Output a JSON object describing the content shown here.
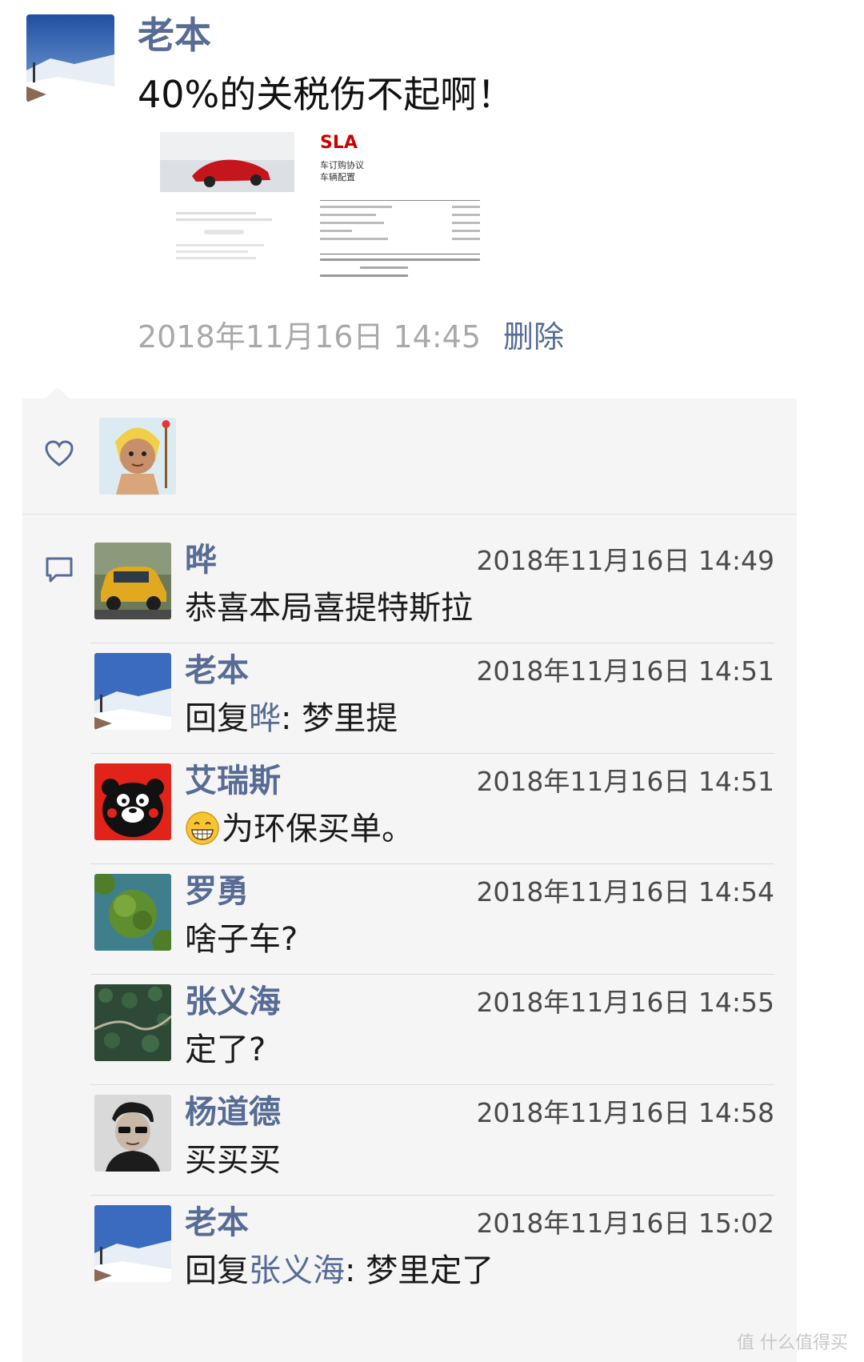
{
  "post": {
    "author": "老本",
    "text": "40%的关税伤不起啊！",
    "time": "2018年11月16日 14:45",
    "delete_label": "删除",
    "images": [
      {
        "icon": "tesla-car-photo"
      },
      {
        "icon": "tesla-order-document",
        "logo_text": "SLA",
        "lines": [
          "车订购协议",
          "车辆配置"
        ]
      }
    ]
  },
  "likes": {
    "icon": "heart-icon",
    "users": [
      {
        "avatar": "cartoon-avatar"
      }
    ]
  },
  "comments": [
    {
      "name": "晔",
      "time": "2018年11月16日 14:49",
      "text": "恭喜本局喜提特斯拉",
      "avatar": "yellow-car-avatar"
    },
    {
      "name": "老本",
      "time": "2018年11月16日 14:51",
      "reply_prefix": "回复",
      "reply_to": "晔",
      "reply_sep": ": ",
      "text": "梦里提",
      "avatar": "snow-mountain-avatar"
    },
    {
      "name": "艾瑞斯",
      "time": "2018年11月16日 14:51",
      "emoji": "grinning-face",
      "text": "为环保买单。",
      "avatar": "kumamon-avatar"
    },
    {
      "name": "罗勇",
      "time": "2018年11月16日 14:54",
      "text": "啥子车?",
      "avatar": "forest-river-avatar"
    },
    {
      "name": "张义海",
      "time": "2018年11月16日 14:55",
      "text": "定了?",
      "avatar": "forest-road-avatar"
    },
    {
      "name": "杨道德",
      "time": "2018年11月16日 14:58",
      "text": "买买买",
      "avatar": "man-portrait-avatar"
    },
    {
      "name": "老本",
      "time": "2018年11月16日 15:02",
      "reply_prefix": "回复",
      "reply_to": "张义海",
      "reply_sep": ": ",
      "text": "梦里定了",
      "avatar": "snow-mountain-avatar"
    }
  ],
  "watermark": "值 什么值得买",
  "colors": {
    "link": "#576b95",
    "panel": "#f5f5f5",
    "time_gray": "#a9a9a9"
  }
}
